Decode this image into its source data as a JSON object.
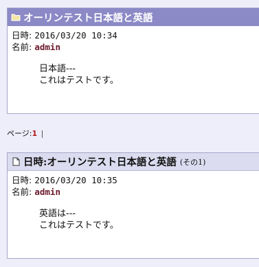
{
  "posts": [
    {
      "title": "オーリンテスト日本語と英語",
      "subtitle": "",
      "icon": "folder-icon",
      "date_label": "日時:",
      "date_value": "2016/03/20 10:34",
      "author_label": "名前:",
      "author": "admin",
      "message_lines": [
        "日本語---",
        "これはテストです。"
      ]
    },
    {
      "title": "日時:オーリンテスト日本語と英語",
      "subtitle": "(その1)",
      "icon": "document-icon",
      "date_label": "日時:",
      "date_value": "2016/03/20 10:35",
      "author_label": "名前:",
      "author": "admin",
      "message_lines": [
        "英語は---",
        "これはテストです。"
      ]
    }
  ],
  "pager": {
    "label": "ページ:",
    "current": "1",
    "separator": "|"
  },
  "colors": {
    "page_background": "#eeeefb",
    "header_active": "#8b89c6",
    "header_inactive": "#dcdcf0",
    "author": "#6b1a2c",
    "pager_current": "#b31a1a"
  }
}
